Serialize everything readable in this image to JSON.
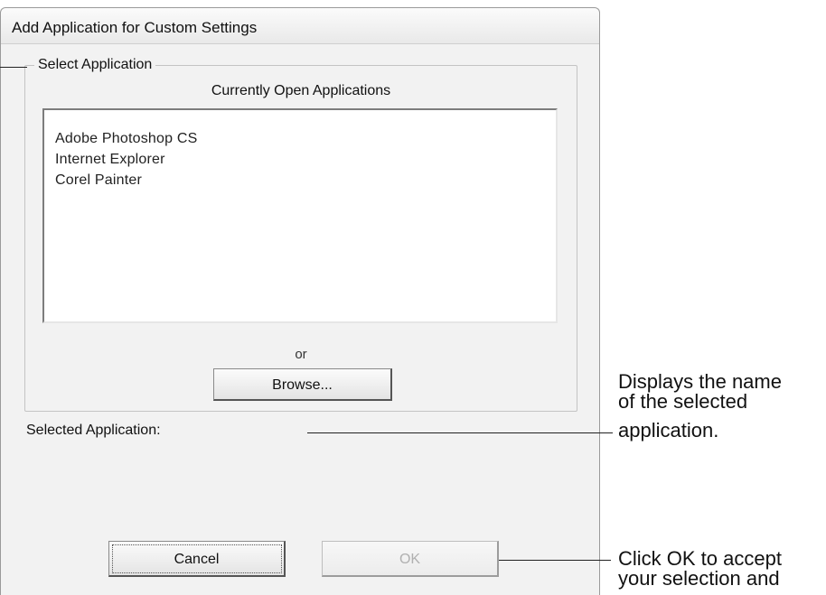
{
  "dialog": {
    "title": "Add Application for Custom Settings",
    "group_label": "Select Application",
    "list_caption": "Currently Open Applications",
    "applications": [
      "Adobe Photoshop CS",
      "Internet Explorer",
      "Corel Painter"
    ],
    "or_label": "or",
    "browse_label": "Browse...",
    "selected_label": "Selected Application:",
    "cancel_label": "Cancel",
    "ok_label": "OK"
  },
  "callouts": {
    "selected_name": {
      "line1": "Displays the name",
      "line2": "of the selected",
      "line3": "application."
    },
    "ok_button": {
      "line1": "Click OK to accept",
      "line2": "your selection and"
    }
  }
}
